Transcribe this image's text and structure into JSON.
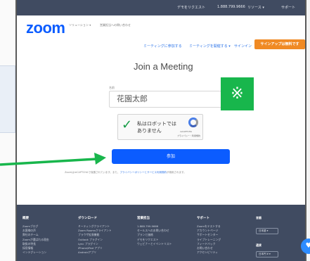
{
  "topbar": {
    "items": [
      "デモをリクエスト",
      "1.888.799.9666",
      "リソース ▾",
      "サポート"
    ]
  },
  "header": {
    "logo": "zoom",
    "breadcrumbs": [
      "ソリューション ▾",
      "営業担当への問い合わせ"
    ]
  },
  "nav": {
    "join_link": "ミーティングに参加する",
    "host_link": "ミーティングを開催する ▾",
    "signin_link": "サインイン",
    "signup_button": "サインアップは無料です"
  },
  "form": {
    "title": "Join a Meeting",
    "name_label": "名前",
    "name_value": "花園太郎",
    "mark": "※",
    "captcha": {
      "check": "✓",
      "text": "私はロボットではありません",
      "brand": "reCAPTCHA",
      "privacy": "プライバシー・利用規約"
    },
    "join_button": "参加",
    "terms_prefix": "ZoomはreCAPTCHAで保護されています。また、",
    "terms_link": "プライバシーポリシーとサービス利用規約",
    "terms_suffix": "が適用されます。"
  },
  "footer": {
    "columns": [
      {
        "heading": "概要",
        "items": [
          "Zoomブログ",
          "お客様の声",
          "弊社のチーム",
          "Zoomが選ばれる理由",
          "取扱の特長",
          "採用情報",
          "インテグレーション"
        ]
      },
      {
        "heading": "ダウンロード",
        "items": [
          "ミーティングクライアント",
          "Zoom Roomsクライアント",
          "ブラウザ拡張機能",
          "Outlook プラグイン",
          "Lync プラグイン",
          "iPhone/iPad アプリ",
          "Androidアプリ"
        ]
      },
      {
        "heading": "営業担当",
        "items": [
          "1.888.799.9666",
          "セールスへのお問い合わせ",
          "プランと価格",
          "デモをリクエスト",
          "ウェビナーとイベントリスト"
        ]
      },
      {
        "heading": "サポート",
        "items": [
          "Zoomをテストする",
          "アカウントページ",
          "サポートセンター",
          "ライブトレーニング",
          "フィードバック",
          "お問い合わせ",
          "アクセシビリティ"
        ]
      }
    ],
    "language_heading": "言語",
    "language_value": "日本語 ▾",
    "currency_heading": "通貨",
    "currency_value": "日本円 ¥ ▾",
    "help_icon": "♥"
  },
  "colors": {
    "brand": "#0b5cff",
    "signup": "#f08a24",
    "annotation_green": "#18b64c",
    "footer_bg": "#404b61"
  }
}
